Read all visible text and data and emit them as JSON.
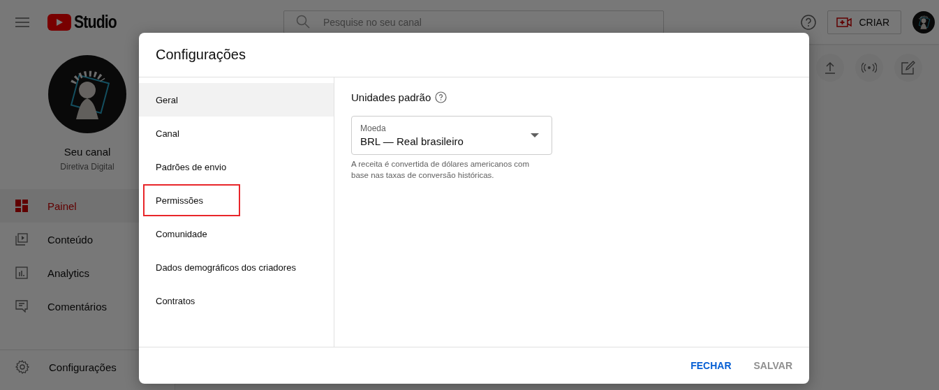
{
  "header": {
    "logo_text": "Studio",
    "search": {
      "placeholder": "Pesquise no seu canal"
    },
    "create_button": "CRIAR"
  },
  "channel": {
    "name": "Seu canal",
    "subtitle": "Diretiva Digital"
  },
  "sidebar": {
    "items": [
      {
        "label": "Painel",
        "kind": "dashboard",
        "selected": true
      },
      {
        "label": "Conteúdo",
        "kind": "content",
        "selected": false
      },
      {
        "label": "Analytics",
        "kind": "analytics",
        "selected": false
      },
      {
        "label": "Comentários",
        "kind": "comments",
        "selected": false
      }
    ],
    "footer_items": [
      {
        "label": "Configurações",
        "kind": "settings",
        "selected": false
      }
    ]
  },
  "dialog": {
    "title": "Configurações",
    "nav": [
      {
        "label": "Geral",
        "selected": true,
        "highlighted": false
      },
      {
        "label": "Canal",
        "selected": false,
        "highlighted": false
      },
      {
        "label": "Padrões de envio",
        "selected": false,
        "highlighted": false
      },
      {
        "label": "Permissões",
        "selected": false,
        "highlighted": true
      },
      {
        "label": "Comunidade",
        "selected": false,
        "highlighted": false
      },
      {
        "label": "Dados demográficos dos criadores",
        "selected": false,
        "highlighted": false
      },
      {
        "label": "Contratos",
        "selected": false,
        "highlighted": false
      }
    ],
    "section": {
      "title": "Unidades padrão",
      "currency": {
        "label": "Moeda",
        "value": "BRL — Real brasileiro"
      },
      "help_text": "A receita é convertida de dólares americanos com base nas taxas de conversão históricas."
    },
    "buttons": [
      {
        "label": "FECHAR",
        "disabled": false
      },
      {
        "label": "SALVAR",
        "disabled": true
      }
    ]
  }
}
